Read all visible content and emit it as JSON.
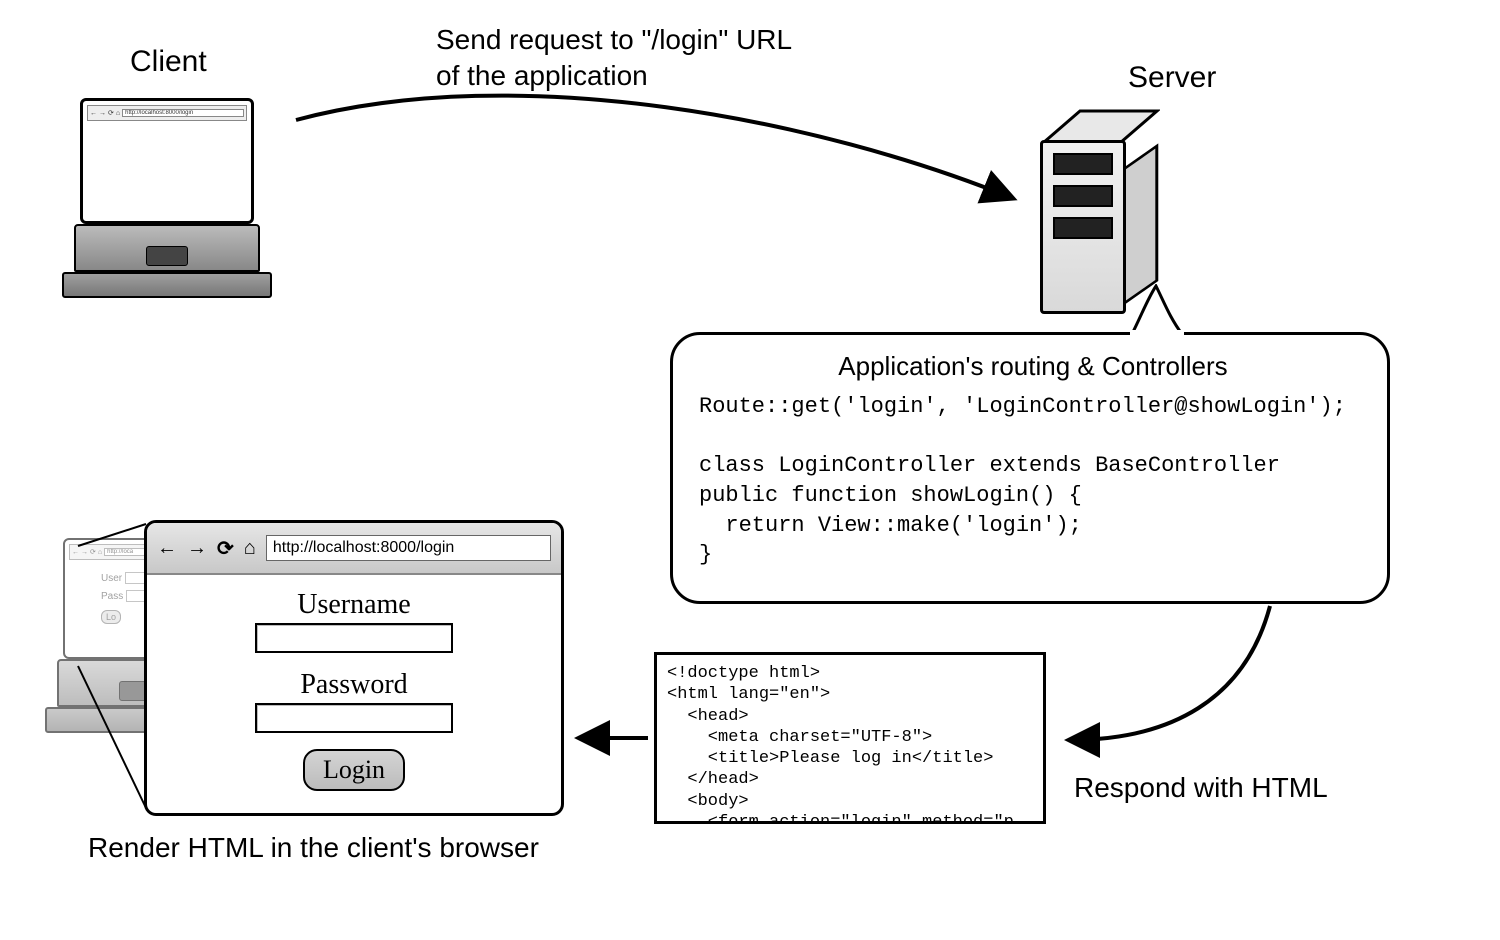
{
  "labels": {
    "client": "Client",
    "server": "Server",
    "send_request_l1": "Send request to \"/login\" URL",
    "send_request_l2": "of the application",
    "respond": "Respond with HTML",
    "render": "Render HTML in the client's browser"
  },
  "bubble": {
    "title": "Application's routing & Controllers",
    "code": "Route::get('login', 'LoginController@showLogin');\n\nclass LoginController extends BaseController\npublic function showLogin() {\n  return View::make('login');\n}"
  },
  "html_snippet": "<!doctype html>\n<html lang=\"en\">\n  <head>\n    <meta charset=\"UTF-8\">\n    <title>Please log in</title>\n  </head>\n  <body>\n    <form action=\"login\" method=\"p",
  "browser": {
    "url": "http://localhost:8000/login",
    "username_label": "Username",
    "password_label": "Password",
    "login_button": "Login"
  },
  "mini": {
    "user": "User",
    "pass": "Pass",
    "login": "Lo"
  }
}
